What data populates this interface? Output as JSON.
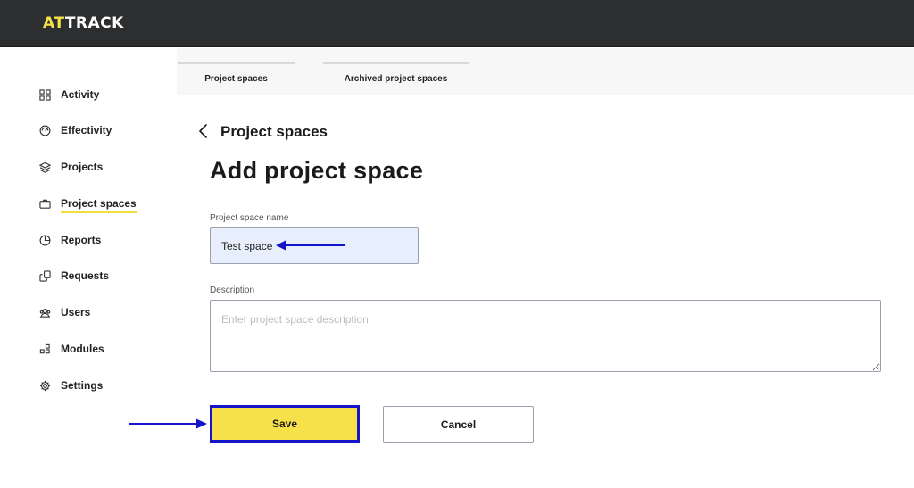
{
  "app": {
    "logo_accent": "AT",
    "logo_rest": "TRACK"
  },
  "sidebar": {
    "items": [
      {
        "label": "Activity",
        "icon": "grid-icon"
      },
      {
        "label": "Effectivity",
        "icon": "gauge-icon"
      },
      {
        "label": "Projects",
        "icon": "layers-icon"
      },
      {
        "label": "Project spaces",
        "icon": "briefcase-icon",
        "active": true
      },
      {
        "label": "Reports",
        "icon": "pie-chart-icon"
      },
      {
        "label": "Requests",
        "icon": "request-icon"
      },
      {
        "label": "Users",
        "icon": "users-icon"
      },
      {
        "label": "Modules",
        "icon": "modules-icon"
      },
      {
        "label": "Settings",
        "icon": "gear-icon"
      }
    ]
  },
  "tabs": [
    {
      "label": "Project spaces"
    },
    {
      "label": "Archived project spaces"
    }
  ],
  "header": {
    "back_label": "Project spaces",
    "title": "Add project space"
  },
  "form": {
    "name_label": "Project space name",
    "name_value": "Test space",
    "description_label": "Description",
    "description_placeholder": "Enter project space description",
    "description_value": ""
  },
  "actions": {
    "save_label": "Save",
    "cancel_label": "Cancel"
  },
  "colors": {
    "topbar": "#2d2e30",
    "accent_yellow": "#f7e14b",
    "annotation_blue": "#1414c8",
    "input_fill": "#e8effc"
  }
}
